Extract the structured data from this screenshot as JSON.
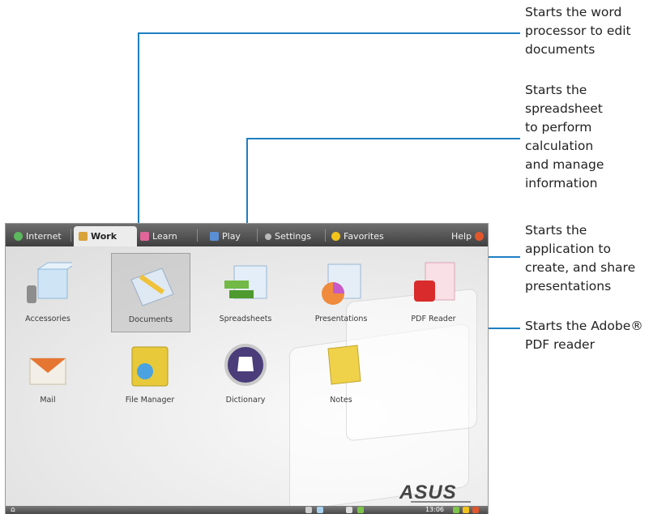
{
  "tabs": [
    {
      "label": "Internet"
    },
    {
      "label": "Work"
    },
    {
      "label": "Learn"
    },
    {
      "label": "Play"
    },
    {
      "label": "Settings"
    },
    {
      "label": "Favorites"
    },
    {
      "label": "Help"
    }
  ],
  "apps": [
    {
      "label": "Accessories"
    },
    {
      "label": "Documents"
    },
    {
      "label": "Spreadsheets"
    },
    {
      "label": "Presentations"
    },
    {
      "label": "PDF Reader"
    },
    {
      "label": "Mail"
    },
    {
      "label": "File Manager"
    },
    {
      "label": "Dictionary"
    },
    {
      "label": "Notes"
    }
  ],
  "logo": "ASUS",
  "taskbar": {
    "clock": "13:06"
  },
  "callouts": [
    {
      "text": "Starts the word\nprocessor to edit\ndocuments"
    },
    {
      "text": "Starts the\nspreadsheet\nto perform\ncalculation\nand manage\ninformation"
    },
    {
      "text": "Starts the\napplication to\ncreate, and share\npresentations"
    },
    {
      "text": "Starts the Adobe®\nPDF reader"
    }
  ],
  "colors": {
    "callout_line": "#1e7fc2",
    "active_tab_bg": "#ececec"
  }
}
